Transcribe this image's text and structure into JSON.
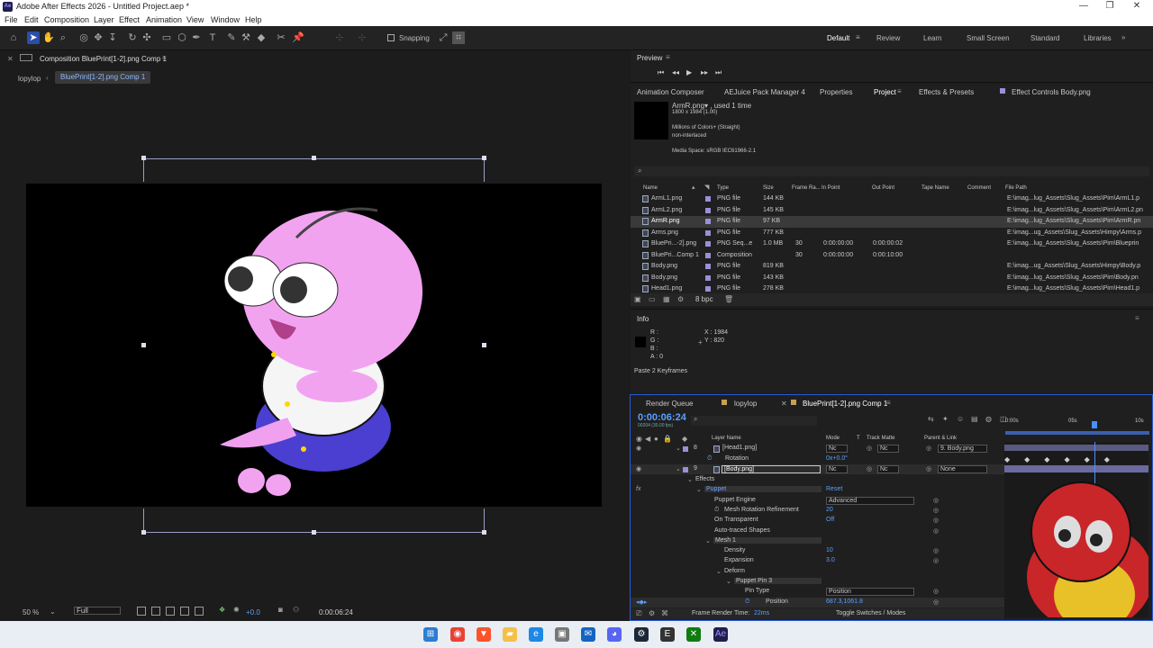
{
  "window": {
    "title": "Adobe After Effects 2026 - Untitled Project.aep *",
    "app_logo": "Ae",
    "controls": [
      "—",
      "❐",
      "✕"
    ]
  },
  "menu": [
    "File",
    "Edit",
    "Composition",
    "Layer",
    "Effect",
    "Animation",
    "View",
    "Window",
    "Help"
  ],
  "toolbar": {
    "snapping_label": "Snapping"
  },
  "workspaces": [
    "Default",
    "Review",
    "Learn",
    "Small Screen",
    "Standard",
    "Libraries"
  ],
  "composition_panel": {
    "title": "Composition BluePrint[1-2].png Comp 1",
    "crumb_1": "lopylop",
    "crumb_2": "BluePrint[1-2].png Comp 1",
    "zoom": "50 %",
    "resolution": "Full",
    "exposure": "+0.0",
    "timecode": "0:00:06:24"
  },
  "preview": {
    "title": "Preview"
  },
  "tabs_row": [
    "Animation Composer",
    "AEJuice Pack Manager 4",
    "Properties",
    "Project",
    "Effects & Presets",
    "Effect Controls Body.png"
  ],
  "project_info": {
    "name_line": "ArmR.png▾ , used 1 time",
    "dims": "1800 x 1984 (1.00)",
    "colors": "Millions of Colors+ (Straight)",
    "interlace": "non-interlaced",
    "media_space": "Media Space: sRGB IEC61966-2.1",
    "bpc": "8 bpc"
  },
  "project_columns": [
    "Name",
    "Type",
    "Size",
    "Frame Ra...",
    "In Point",
    "Out Point",
    "Tape Name",
    "Comment",
    "File Path"
  ],
  "project_rows": [
    {
      "name": "ArmL1.png",
      "type": "PNG file",
      "size": "144 KB",
      "fps": "",
      "in": "",
      "out": "",
      "path": "E:\\imag...lug_Assets\\Slug_Assets\\Pim\\ArmL1.p"
    },
    {
      "name": "ArmL2.png",
      "type": "PNG file",
      "size": "145 KB",
      "fps": "",
      "in": "",
      "out": "",
      "path": "E:\\imag...lug_Assets\\Slug_Assets\\Pim\\ArmL2.pn"
    },
    {
      "name": "ArmR.png",
      "type": "PNG file",
      "size": "97 KB",
      "fps": "",
      "in": "",
      "out": "",
      "path": "E:\\imag...lug_Assets\\Slug_Assets\\Pim\\ArmR.pn"
    },
    {
      "name": "Arms.png",
      "type": "PNG file",
      "size": "777 KB",
      "fps": "",
      "in": "",
      "out": "",
      "path": "E:\\imag...ug_Assets\\Slug_Assets\\Himpy\\Arms.p"
    },
    {
      "name": "BluePri...-2].png",
      "type": "PNG Seq...e",
      "size": "1.0 MB",
      "fps": "30",
      "in": "0:00:00:00",
      "out": "0:00:00:02",
      "path": "E:\\imag...lug_Assets\\Slug_Assets\\Pim\\Blueprin"
    },
    {
      "name": "BluePri...Comp 1",
      "type": "Composition",
      "size": "",
      "fps": "30",
      "in": "0:00:00:00",
      "out": "0:00:10:00",
      "path": ""
    },
    {
      "name": "Body.png",
      "type": "PNG file",
      "size": "819 KB",
      "fps": "",
      "in": "",
      "out": "",
      "path": "E:\\imag...ug_Assets\\Slug_Assets\\Himpy\\Body.p"
    },
    {
      "name": "Body.png",
      "type": "PNG file",
      "size": "143 KB",
      "fps": "",
      "in": "",
      "out": "",
      "path": "E:\\imag...lug_Assets\\Slug_Assets\\Pim\\Body.pn"
    },
    {
      "name": "Head1.png",
      "type": "PNG file",
      "size": "278 KB",
      "fps": "",
      "in": "",
      "out": "",
      "path": "E:\\imag...lug_Assets\\Slug_Assets\\Pim\\Head1.p"
    }
  ],
  "info_panel": {
    "title": "Info",
    "r": "R :",
    "g": "G :",
    "b": "B :",
    "a": "A : 0",
    "x": "X : 1984",
    "y": "Y : 820",
    "message": "Paste 2 Keyframes"
  },
  "timeline": {
    "tabs": [
      "Render Queue",
      "lopylop",
      "BluePrint[1-2].png Comp 1"
    ],
    "timecode": "0:00:06:24",
    "timecode_sub": "00204 (30.00 fps)",
    "ruler": [
      "0:00s",
      "05s",
      "10s"
    ],
    "columns": [
      "Layer Name",
      "Mode",
      "T",
      "Track Matte",
      "Parent & Link"
    ],
    "layers": [
      {
        "num": "8",
        "name": "[Head1.png]",
        "mode": "Nc",
        "matte": "Nc",
        "parent": "9. Body.png"
      },
      {
        "num": "9",
        "name": "[Body.png]",
        "mode": "Nc",
        "matte": "Nc",
        "parent": "None"
      }
    ],
    "rotation_label": "Rotation",
    "rotation_value": "0x+0.0°",
    "props": [
      {
        "label": "Effects",
        "value": ""
      },
      {
        "label": "Puppet",
        "value": "Reset"
      },
      {
        "label": "Puppet Engine",
        "value": "Advanced"
      },
      {
        "label": "Mesh Rotation Refinement",
        "value": "20"
      },
      {
        "label": "On Transparent",
        "value": "Off"
      },
      {
        "label": "Auto-traced Shapes",
        "value": ""
      },
      {
        "label": "Mesh 1",
        "value": ""
      },
      {
        "label": "Density",
        "value": "10"
      },
      {
        "label": "Expansion",
        "value": "3.0"
      },
      {
        "label": "Deform",
        "value": ""
      },
      {
        "label": "Puppet Pin 3",
        "value": ""
      },
      {
        "label": "Pin Type",
        "value": "Position"
      },
      {
        "label": "Position",
        "value": "687.3,1061.8"
      }
    ],
    "frame_render": "Frame Render Time:",
    "frame_render_val": "22ms",
    "toggle": "Toggle Switches / Modes"
  },
  "colors": {
    "accent": "#2b5ad8",
    "panel": "#1f1f1f",
    "pink": "#f1a0f0",
    "purple": "#5a47d6"
  }
}
